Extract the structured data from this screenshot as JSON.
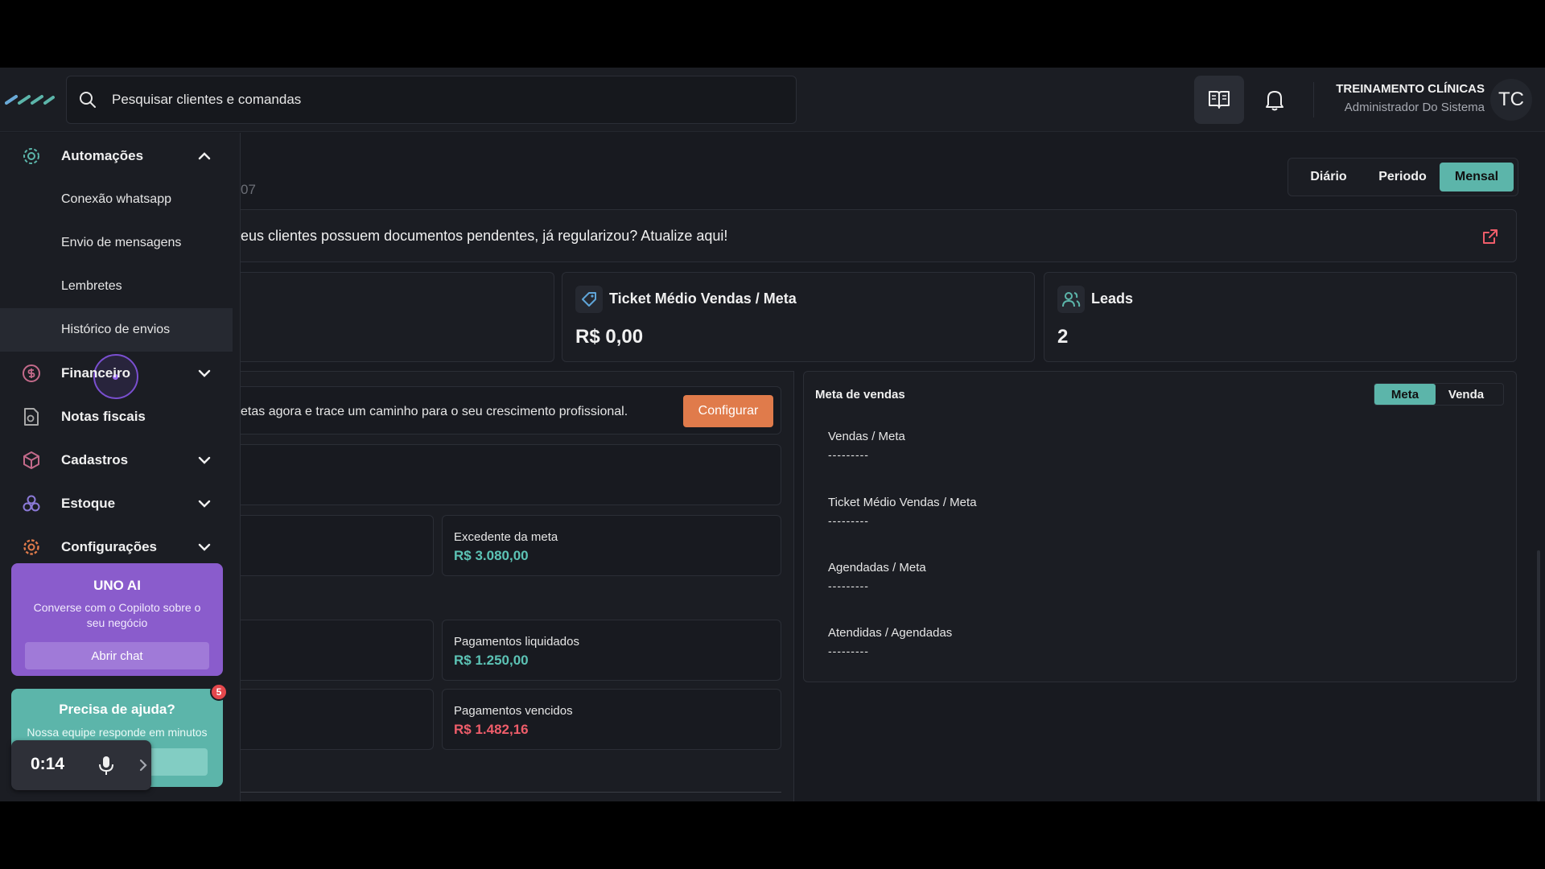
{
  "header": {
    "search_placeholder": "Pesquisar clientes e comandas",
    "user_name": "TREINAMENTO CLÍNICAS",
    "user_role": "Administrador Do Sistema",
    "avatar_initials": "TC"
  },
  "sidebar": {
    "automacoes": "Automações",
    "sub_items": [
      "Conexão whatsapp",
      "Envio de mensagens",
      "Lembretes",
      "Histórico de envios"
    ],
    "financeiro": "Financeiro",
    "notas": "Notas fiscais",
    "cadastros": "Cadastros",
    "estoque": "Estoque",
    "configuracoes": "Configurações"
  },
  "uno_ai": {
    "title": "UNO AI",
    "desc": "Converse com o Copiloto sobre o seu negócio",
    "button": "Abrir chat"
  },
  "help": {
    "title": "Precisa de ajuda?",
    "desc": "Nossa equipe responde em minutos",
    "badge": "5"
  },
  "recorder": {
    "time": "0:14"
  },
  "period": {
    "daily": "Diário",
    "period": "Periodo",
    "monthly": "Mensal"
  },
  "year_fragment": "07",
  "alert": {
    "text": "eus clientes possuem documentos pendentes, já regularizou? Atualize aqui!"
  },
  "kpis": {
    "ticket_title": "Ticket Médio Vendas / Meta",
    "ticket_value": "R$ 0,00",
    "leads_title": "Leads",
    "leads_value": "2"
  },
  "goals": {
    "cta_text": "etas agora e trace um caminho para o seu crescimento profissional.",
    "cta_button": "Configurar",
    "excedente_label": "Excedente da meta",
    "excedente_value": "R$ 3.080,00",
    "liquidados_label": "Pagamentos liquidados",
    "liquidados_value": "R$ 1.250,00",
    "vencidos_label": "Pagamentos vencidos",
    "vencidos_value": "R$ 1.482,16"
  },
  "meta_vendas": {
    "title": "Meta de vendas",
    "tab_meta": "Meta",
    "tab_venda": "Venda",
    "metrics": [
      {
        "label": "Vendas / Meta",
        "value": "---------"
      },
      {
        "label": "Ticket Médio Vendas / Meta",
        "value": "---------"
      },
      {
        "label": "Agendadas / Meta",
        "value": "---------"
      },
      {
        "label": "Atendidas / Agendadas",
        "value": "---------"
      }
    ]
  },
  "colors": {
    "accent": "#5cb5aa",
    "purple": "#8a5ccc",
    "orange": "#e07b4b",
    "red": "#ef5d6a"
  }
}
